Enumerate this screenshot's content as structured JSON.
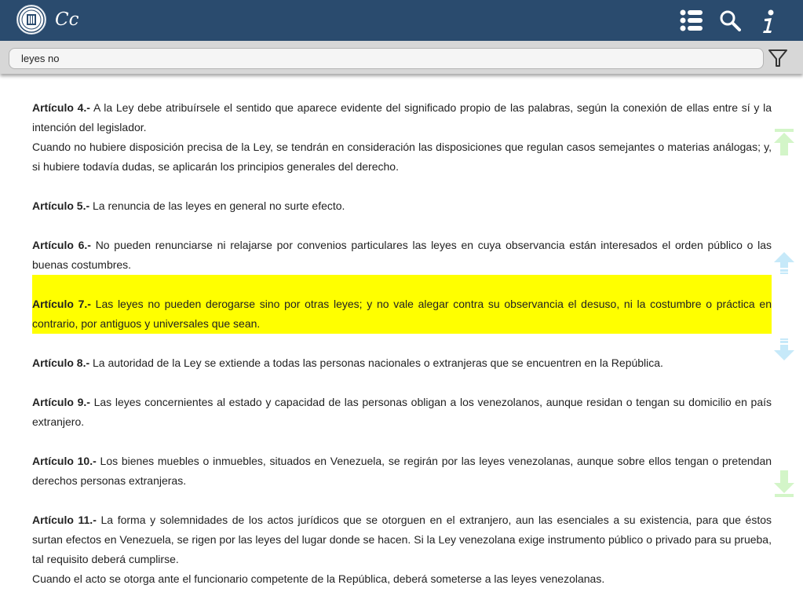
{
  "app": {
    "title": "Cc",
    "logo_label": "logo-seal"
  },
  "toolbar": {
    "icons": [
      "list-icon",
      "search-icon",
      "info-icon"
    ]
  },
  "search": {
    "value": "leyes no",
    "filter_icon": "filter-icon"
  },
  "colors": {
    "topbar": "#2a4b6e",
    "highlight": "#ffff00",
    "nav_green": "#d3f5c8",
    "nav_blue": "#c6e9f9"
  },
  "articles": [
    {
      "number": "Artículo 4.-",
      "paragraphs": [
        "A la Ley debe atribuírsele el sentido que aparece evidente del significado propio de las palabras, según la conexión de ellas entre sí y la intención del legislador.",
        "Cuando no hubiere disposición precisa de la Ley, se tendrán en consideración las disposiciones que regulan casos semejantes o materias análogas; y, si hubiere todavía dudas, se aplicarán los principios generales del derecho."
      ],
      "highlighted": false
    },
    {
      "number": "Artículo 5.-",
      "paragraphs": [
        "La renuncia de las leyes en general no surte efecto."
      ],
      "highlighted": false
    },
    {
      "number": "Artículo 6.-",
      "paragraphs": [
        "No pueden renunciarse ni relajarse por convenios particulares las leyes en cuya observancia están interesados el orden público o las buenas costumbres."
      ],
      "highlighted": false
    },
    {
      "number": "Artículo 7.-",
      "paragraphs": [
        "Las leyes no pueden derogarse sino por otras leyes; y no vale alegar contra su observancia el desuso, ni la costumbre o práctica en contrario, por antiguos y universales que sean."
      ],
      "highlighted": true
    },
    {
      "number": "Artículo 8.-",
      "paragraphs": [
        "La autoridad de la Ley se extiende a todas las personas nacionales o extranjeras que se encuentren en la República."
      ],
      "highlighted": false
    },
    {
      "number": "Artículo 9.-",
      "paragraphs": [
        "Las leyes concernientes al estado y capacidad de las personas obligan a los venezolanos, aunque residan o tengan su domicilio en país extranjero."
      ],
      "highlighted": false
    },
    {
      "number": "Artículo 10.-",
      "paragraphs": [
        "Los bienes muebles o inmuebles, situados en Venezuela, se regirán por las leyes venezolanas, aunque sobre ellos tengan o pretendan derechos personas extranjeras."
      ],
      "highlighted": false
    },
    {
      "number": "Artículo 11.-",
      "paragraphs": [
        "La forma y solemnidades de los actos jurídicos que se otorguen en el extranjero, aun las esenciales a su existencia, para que éstos surtan efectos en Venezuela, se rigen por las leyes del lugar donde se hacen. Si la Ley venezolana exige instrumento público o privado para su prueba, tal requisito deberá cumplirse.",
        "Cuando el acto se otorga ante el funcionario competente de la República, deberá someterse a las leyes venezolanas."
      ],
      "highlighted": false
    }
  ],
  "side_nav": [
    "scroll-top-icon",
    "previous-match-icon",
    "next-match-icon",
    "scroll-bottom-icon"
  ]
}
